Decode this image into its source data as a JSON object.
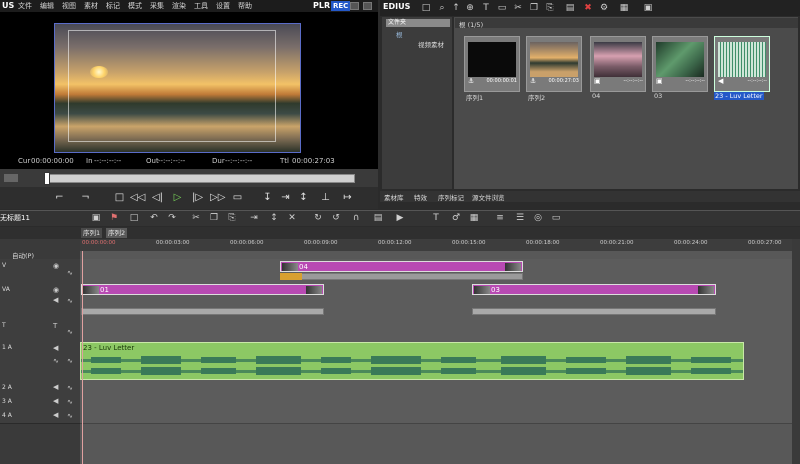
{
  "menu": {
    "logo": "US",
    "items": [
      "文件",
      "编辑",
      "视图",
      "素材",
      "标记",
      "模式",
      "采集",
      "渲染",
      "工具",
      "设置",
      "帮助"
    ],
    "plr": "PLR",
    "rec": "REC"
  },
  "player": {
    "cur_label": "Cur",
    "cur_value": "00:00:00:00",
    "in_label": "In",
    "in_value": "--:--:--:--",
    "out_label": "Out",
    "out_value": "--:--:--:--",
    "dur_label": "Dur",
    "dur_value": "--:--:--:--",
    "ttl_label": "Ttl",
    "ttl_value": "00:00:27:03"
  },
  "bin": {
    "title": "EDIUS",
    "tree_header": "文件夹",
    "tree_root": "根",
    "tree_item": "视频素材",
    "folder_label": "根 (1/5)",
    "clips": [
      {
        "label": "序列1",
        "tc": "00:00:00:01",
        "thumb": "#0a0a0a"
      },
      {
        "label": "序列2",
        "tc": "00:00:27:03",
        "thumb": "#c9a06a"
      },
      {
        "label": "04",
        "tc": "--:--:--:--",
        "thumb": "#7a5c68"
      },
      {
        "label": "03",
        "tc": "--:--:--:--",
        "thumb": "#3e6a4c"
      },
      {
        "label": "23 - Luv Letter",
        "tc": "--:--:--:--",
        "thumb": "#cfe6d8"
      }
    ],
    "tabs": [
      "素材库",
      "特效",
      "序列标记",
      "源文件浏览"
    ]
  },
  "timeline": {
    "title": "无标题11",
    "seq_tabs": [
      "序列1",
      "序列2"
    ],
    "mode_label": "自动(P)",
    "ruler": [
      "00:00:00:00",
      "00:00:03:00",
      "00:00:06:00",
      "00:00:09:00",
      "00:00:12:00",
      "00:00:15:00",
      "00:00:18:00",
      "00:00:21:00",
      "00:00:24:00",
      "00:00:27:00"
    ],
    "tracks": {
      "v": "V",
      "va": "VA",
      "t": "T",
      "a1": "1 A",
      "a2": "2 A",
      "a3": "3 A",
      "a4": "4 A"
    },
    "clips": {
      "v_clip": "04",
      "va_clip1": "01",
      "va_clip2": "03",
      "audio_clip": "23 - Luv Letter"
    }
  }
}
